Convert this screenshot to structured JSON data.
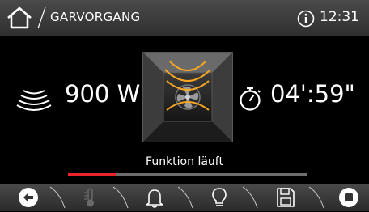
{
  "header": {
    "title": "GARVORGANG",
    "time": "12:31"
  },
  "main": {
    "power": "900 W",
    "timer": "04':59\"",
    "status": "Funktion läuft",
    "progress_percent": 20
  },
  "colors": {
    "accent": "#e8232a",
    "oven_ring": "#f5a623"
  },
  "icons": [
    "home-icon",
    "info-icon",
    "microwave-power-icon",
    "oven-fan-icon",
    "stopwatch-icon",
    "back-icon",
    "thermometer-icon",
    "bell-icon",
    "lightbulb-icon",
    "save-icon",
    "stop-icon"
  ]
}
